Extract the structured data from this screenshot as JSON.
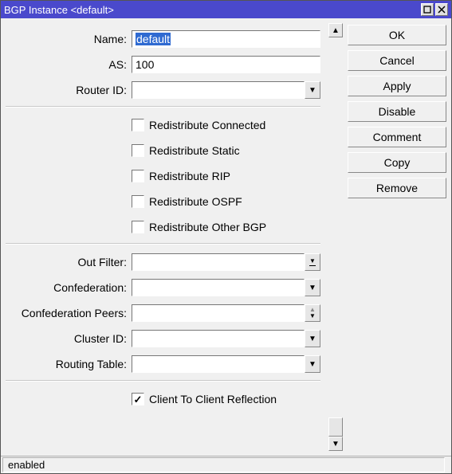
{
  "window": {
    "title": "BGP Instance <default>"
  },
  "buttons": {
    "ok": "OK",
    "cancel": "Cancel",
    "apply": "Apply",
    "disable": "Disable",
    "comment": "Comment",
    "copy": "Copy",
    "remove": "Remove"
  },
  "form": {
    "name": {
      "label": "Name:",
      "value": "default"
    },
    "as": {
      "label": "AS:",
      "value": "100"
    },
    "router_id": {
      "label": "Router ID:",
      "value": ""
    },
    "redistribute_connected": {
      "label": "Redistribute Connected",
      "checked": false
    },
    "redistribute_static": {
      "label": "Redistribute Static",
      "checked": false
    },
    "redistribute_rip": {
      "label": "Redistribute RIP",
      "checked": false
    },
    "redistribute_ospf": {
      "label": "Redistribute OSPF",
      "checked": false
    },
    "redistribute_other_bgp": {
      "label": "Redistribute Other BGP",
      "checked": false
    },
    "out_filter": {
      "label": "Out Filter:",
      "value": ""
    },
    "confederation": {
      "label": "Confederation:",
      "value": ""
    },
    "confederation_peers": {
      "label": "Confederation Peers:",
      "value": ""
    },
    "cluster_id": {
      "label": "Cluster ID:",
      "value": ""
    },
    "routing_table": {
      "label": "Routing Table:",
      "value": ""
    },
    "client_to_client": {
      "label": "Client To Client Reflection",
      "checked": true
    }
  },
  "status": "enabled"
}
